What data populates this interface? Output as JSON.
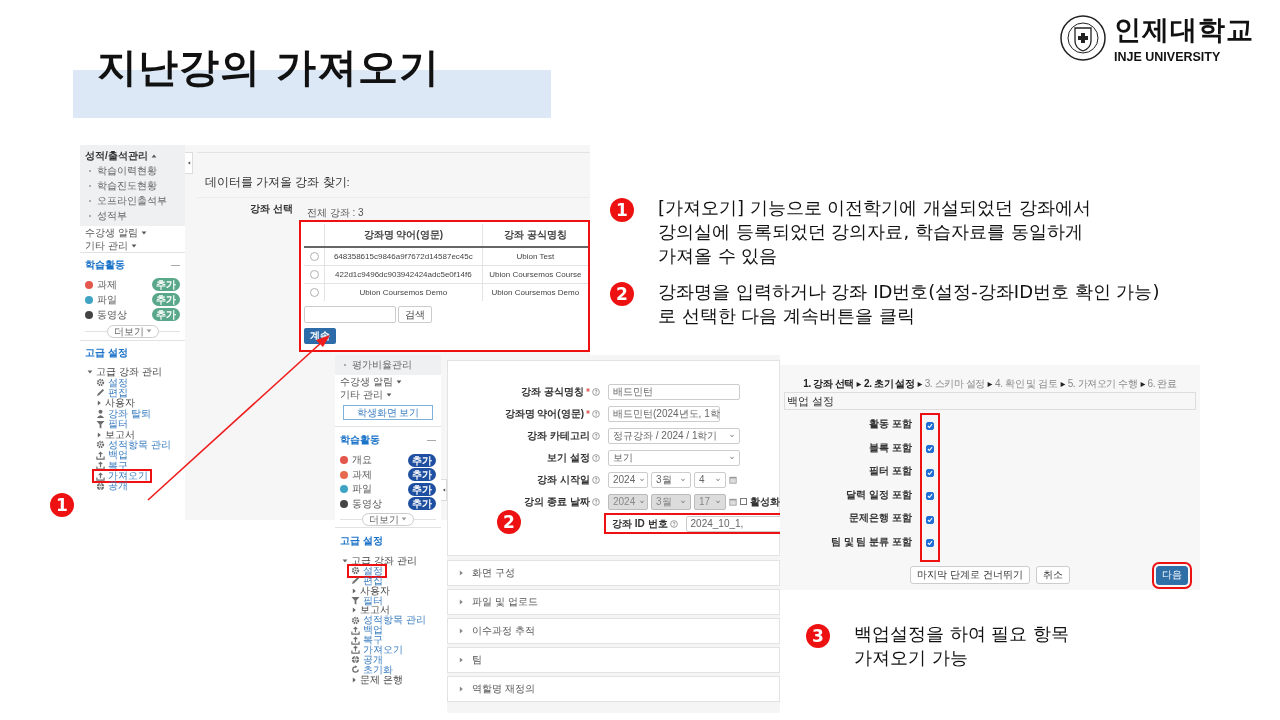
{
  "slide": {
    "title": "지난강의 가져오기",
    "logo": {
      "name": "인제대학교",
      "name_en": "INJE UNIVERSITY"
    }
  },
  "notes": [
    {
      "number": "1",
      "lines": [
        "[가져오기] 기능으로 이전학기에 개설되었던 강좌에서",
        "강의실에 등록되었던 강의자료, 학습자료를 동일하게",
        "가져올 수 있음"
      ]
    },
    {
      "number": "2",
      "lines": [
        "강좌명을 입력하거나 강좌 ID번호(설정-강좌ID번호 확인 가능)",
        "로 선택한 다음 계속버튼을 클릭"
      ]
    },
    {
      "number": "3",
      "lines": [
        "백업설정을 하여 필요 항목",
        "가져오기 가능"
      ]
    }
  ],
  "import_screen": {
    "step_number": "1",
    "sidebar": {
      "entries": [
        {
          "kind": "heading",
          "label": "성적/출석관리",
          "expanded": true
        },
        {
          "kind": "sub",
          "label": "학습이력현황"
        },
        {
          "kind": "sub",
          "label": "학습진도현황"
        },
        {
          "kind": "sub",
          "label": "오프라인출석부"
        },
        {
          "kind": "sub",
          "label": "성적부"
        },
        {
          "kind": "menu",
          "label": "수강생 알림",
          "expanded": false
        },
        {
          "kind": "menu",
          "label": "기타 관리",
          "expanded": false
        }
      ],
      "activity": {
        "title": "학습활동",
        "more": "더보기",
        "items": [
          {
            "label": "과제",
            "color": "#e4574c",
            "action": "추가"
          },
          {
            "label": "파일",
            "color": "#3fa3c4",
            "action": "추가"
          },
          {
            "label": "동영상",
            "color": "#444444",
            "action": "추가"
          }
        ]
      },
      "advanced": {
        "title": "고급 설정",
        "tree": [
          {
            "label": "고급 강좌 관리",
            "kind": "folder",
            "expanded": true,
            "highlighted": false,
            "children": [
              {
                "label": "설정",
                "kind": "settings",
                "highlighted": false
              },
              {
                "label": "편집",
                "kind": "edit",
                "highlighted": false
              },
              {
                "label": "사용자",
                "kind": "folder",
                "expanded": false,
                "highlighted": false
              },
              {
                "label": "강좌 탈퇴",
                "kind": "user",
                "highlighted": false
              },
              {
                "label": "필터",
                "kind": "filter",
                "highlighted": false
              },
              {
                "label": "보고서",
                "kind": "folder",
                "expanded": false,
                "highlighted": false
              },
              {
                "label": "성적항목 관리",
                "kind": "settings",
                "highlighted": false
              },
              {
                "label": "백업",
                "kind": "upload",
                "highlighted": false
              },
              {
                "label": "복구",
                "kind": "upload",
                "highlighted": false
              },
              {
                "label": "가져오기",
                "kind": "upload",
                "highlighted": true
              },
              {
                "label": "공개",
                "kind": "globe",
                "highlighted": false
              }
            ]
          }
        ]
      }
    },
    "heading": "데이터를 가져올 강좌 찾기:",
    "select_label": "강좌 선택",
    "total": "전체 강좌 : 3",
    "table": {
      "columns": [
        "강좌명 약어(영문)",
        "강좌 공식명칭"
      ],
      "rows": [
        {
          "selected": false,
          "cells": [
            "648358615c9846a9f7672d14587ec45c",
            "Ubion Test"
          ]
        },
        {
          "selected": false,
          "cells": [
            "422d1c9496dc903942424adc5e0f14f6",
            "Ubion Coursemos Course"
          ]
        },
        {
          "selected": false,
          "cells": [
            "Ubion Coursemos Demo",
            "Ubion Coursemos Demo"
          ]
        }
      ]
    },
    "search_button": "검색",
    "continue_button": "계속"
  },
  "settings_screen": {
    "step_number": "2",
    "sidebar": {
      "entries": [
        {
          "kind": "sub",
          "label": "평가비율관리"
        },
        {
          "kind": "menu",
          "label": "수강생 알림",
          "expanded": false
        },
        {
          "kind": "menu",
          "label": "기타 관리",
          "expanded": false
        },
        {
          "kind": "button",
          "label": "학생화면 보기"
        }
      ],
      "activity": {
        "title": "학습활동",
        "more": "더보기",
        "items": [
          {
            "label": "개요",
            "color": "#e4574c",
            "action": "추가"
          },
          {
            "label": "과제",
            "color": "#e86a4e",
            "action": "추가"
          },
          {
            "label": "파일",
            "color": "#3fa3c4",
            "action": "추가"
          },
          {
            "label": "동영상",
            "color": "#444444",
            "action": "추가"
          }
        ]
      },
      "advanced": {
        "title": "고급 설정",
        "tree": [
          {
            "label": "고급 강좌 관리",
            "kind": "folder",
            "expanded": true,
            "highlighted": false,
            "children": [
              {
                "label": "설정",
                "kind": "settings",
                "highlighted": true
              },
              {
                "label": "편집",
                "kind": "edit",
                "highlighted": false
              },
              {
                "label": "사용자",
                "kind": "folder",
                "expanded": false,
                "highlighted": false
              },
              {
                "label": "필터",
                "kind": "filter",
                "highlighted": false
              },
              {
                "label": "보고서",
                "kind": "folder",
                "expanded": false,
                "highlighted": false
              },
              {
                "label": "성적항목 관리",
                "kind": "settings",
                "highlighted": false
              },
              {
                "label": "백업",
                "kind": "upload",
                "highlighted": false
              },
              {
                "label": "복구",
                "kind": "upload",
                "highlighted": false
              },
              {
                "label": "가져오기",
                "kind": "upload",
                "highlighted": false
              },
              {
                "label": "공개",
                "kind": "globe",
                "highlighted": false
              },
              {
                "label": "초기화",
                "kind": "reset",
                "highlighted": false
              },
              {
                "label": "문제 은행",
                "kind": "folder",
                "expanded": false,
                "highlighted": false
              }
            ]
          }
        ]
      }
    },
    "form": {
      "fields": [
        {
          "label": "강좌 공식명칭",
          "required": true,
          "kind": "text",
          "value": "배드민턴",
          "highlighted": false
        },
        {
          "label": "강좌명 약어(영문)",
          "required": true,
          "kind": "short_text",
          "value": "배드민턴(2024년도, 1학",
          "highlighted": false
        },
        {
          "label": "강좌 카테고리",
          "required": false,
          "kind": "select",
          "value": "정규강좌 / 2024 / 1학기",
          "highlighted": false
        },
        {
          "label": "보기 설정",
          "required": false,
          "kind": "select",
          "value": "보기",
          "highlighted": false
        },
        {
          "label": "강좌 시작일",
          "required": false,
          "kind": "date",
          "parts": [
            "2024",
            "3월",
            "4"
          ],
          "disabled": false,
          "highlighted": false
        },
        {
          "label": "강의 종료 날짜",
          "required": false,
          "kind": "date",
          "parts": [
            "2024",
            "3월",
            "17"
          ],
          "disabled": true,
          "enable_label": "활성화",
          "enabled": false,
          "highlighted": false
        },
        {
          "label": "강좌 ID 번호",
          "required": false,
          "kind": "short_text",
          "value": "2024_10_1,",
          "highlighted": true
        }
      ],
      "sections": [
        "화면 구성",
        "파일 및 업로드",
        "이수과정 추적",
        "팀",
        "역할명 재정의"
      ]
    }
  },
  "backup_screen": {
    "steps": [
      {
        "label": "1. 강좌 선택",
        "completed": true
      },
      {
        "label": "2. 초기 설정",
        "completed": true
      },
      {
        "label": "3. 스키마 설정",
        "completed": false
      },
      {
        "label": "4. 확인 및 검토",
        "completed": false
      },
      {
        "label": "5. 가져오기 수행",
        "completed": false
      },
      {
        "label": "6. 완료",
        "completed": false
      }
    ],
    "title": "백업 설정",
    "options": [
      {
        "label": "활동 포함",
        "checked": true
      },
      {
        "label": "블록 포함",
        "checked": true
      },
      {
        "label": "필터 포함",
        "checked": true
      },
      {
        "label": "달력 일정 포함",
        "checked": true
      },
      {
        "label": "문제은행 포함",
        "checked": true
      },
      {
        "label": "팀 및 팀 분류 포함",
        "checked": true
      }
    ],
    "buttons": [
      {
        "label": "마지막 단계로 건너뛰기",
        "kind": "default",
        "highlighted": false
      },
      {
        "label": "취소",
        "kind": "default",
        "highlighted": false
      },
      {
        "label": "다음",
        "kind": "primary",
        "highlighted": true
      }
    ]
  }
}
